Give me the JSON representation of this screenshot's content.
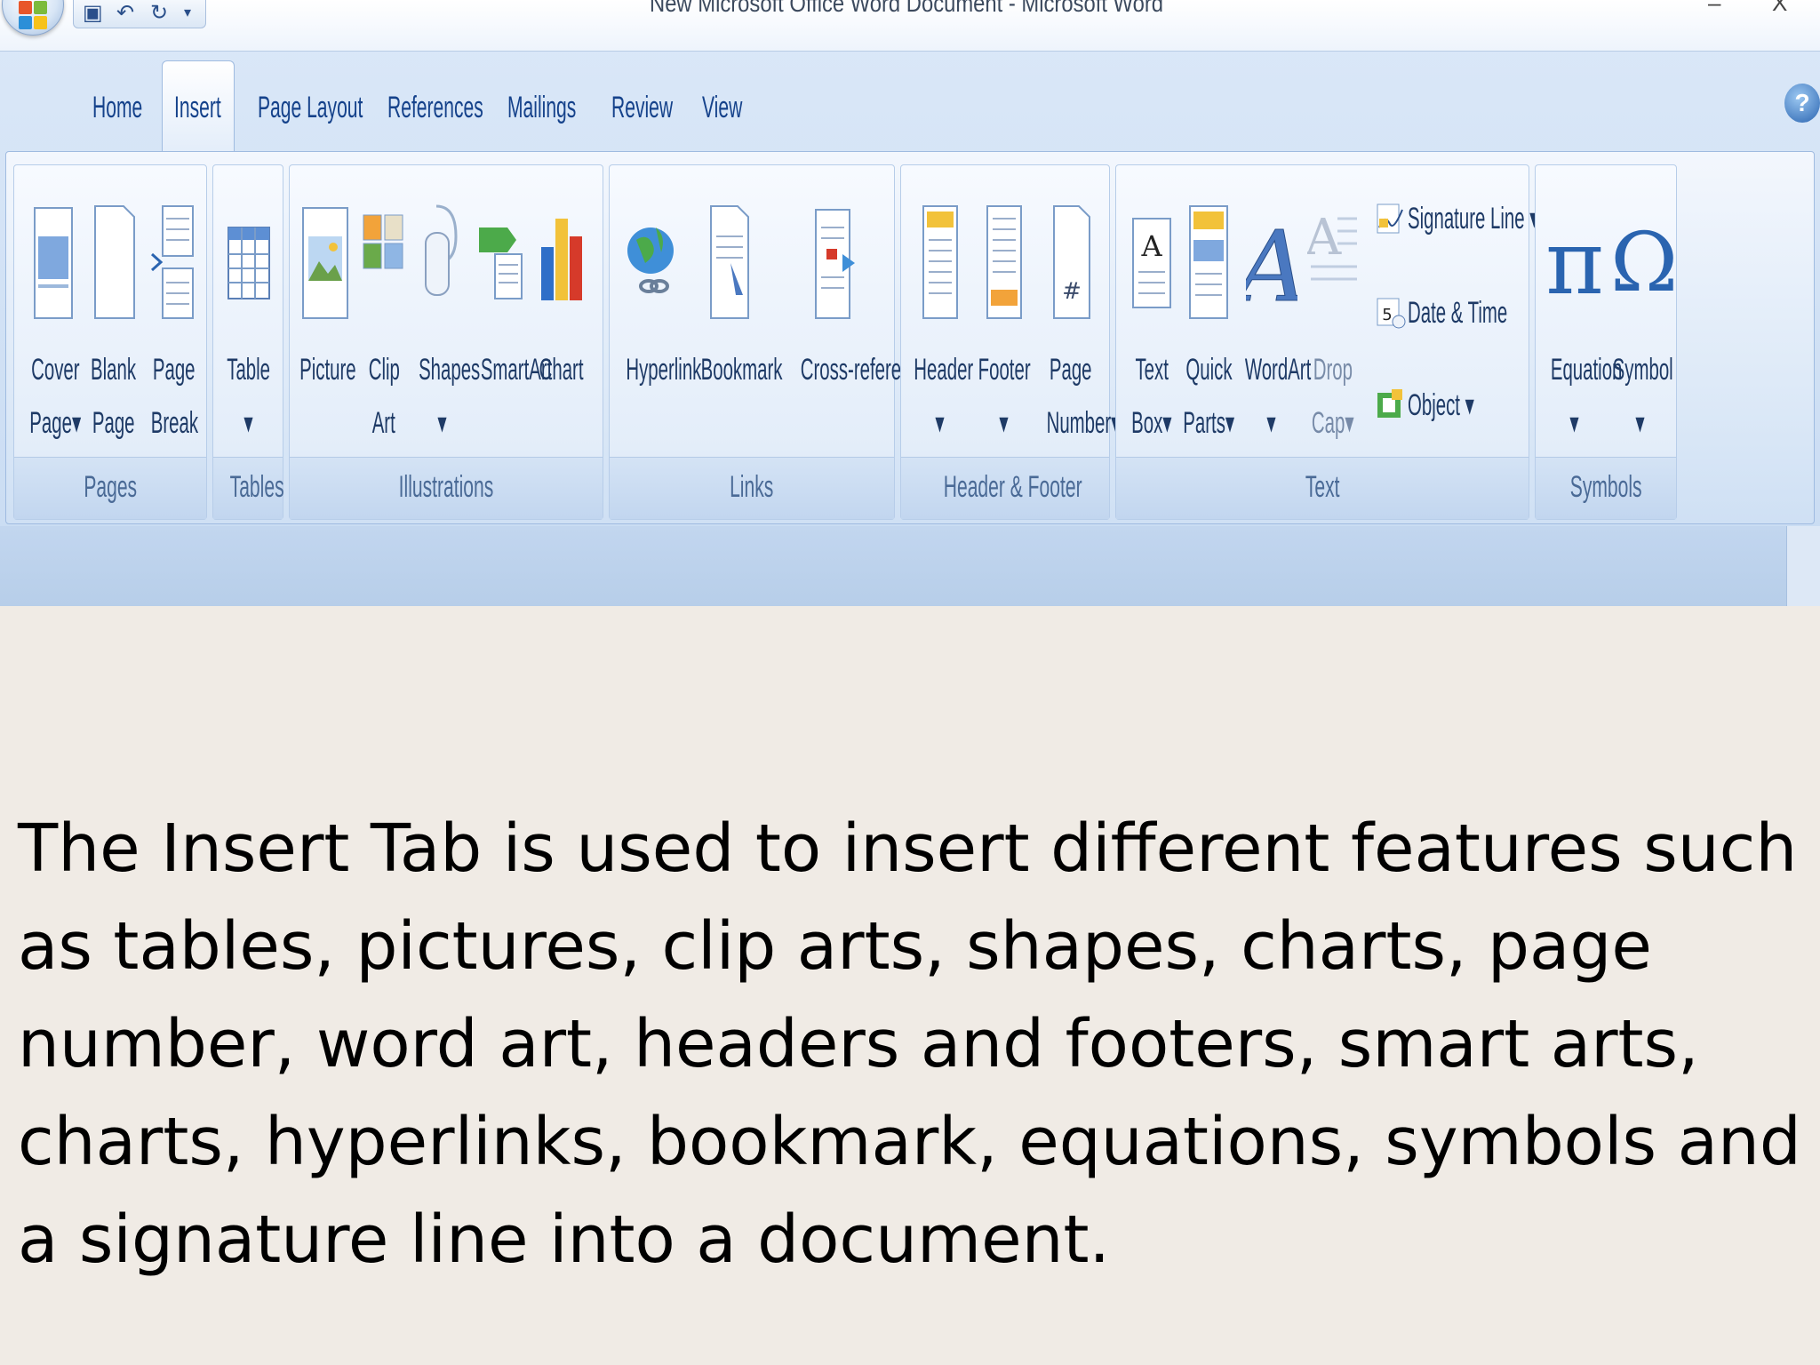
{
  "window": {
    "title": "New Microsoft Office Word Document - Microsoft Word",
    "minimize_glyph": "–",
    "close_glyph": "X"
  },
  "tabs": [
    {
      "label": "Home"
    },
    {
      "label": "Insert",
      "active": true
    },
    {
      "label": "Page Layout"
    },
    {
      "label": "References"
    },
    {
      "label": "Mailings"
    },
    {
      "label": "Review"
    },
    {
      "label": "View"
    }
  ],
  "help_glyph": "?",
  "ribbon": {
    "groups": {
      "pages": {
        "label": "Pages",
        "buttons": [
          {
            "line1": "Cover",
            "line2": "Page▾",
            "icon": "cover-page-icon"
          },
          {
            "line1": "Blank",
            "line2": "Page",
            "icon": "blank-page-icon"
          },
          {
            "line1": "Page",
            "line2": "Break",
            "icon": "page-break-icon"
          }
        ]
      },
      "tables": {
        "label": "Tables",
        "buttons": [
          {
            "line1": "Table",
            "line2": "▾",
            "icon": "table-icon"
          }
        ]
      },
      "illustrations": {
        "label": "Illustrations",
        "buttons": [
          {
            "line1": "Picture",
            "line2": "",
            "icon": "picture-icon"
          },
          {
            "line1": "Clip",
            "line2": "Art",
            "icon": "clip-art-icon"
          },
          {
            "line1": "Shapes",
            "line2": "▾",
            "icon": "shapes-icon"
          },
          {
            "line1": "SmartArt",
            "line2": "",
            "icon": "smartart-icon"
          },
          {
            "line1": "Chart",
            "line2": "",
            "icon": "chart-icon"
          }
        ]
      },
      "links": {
        "label": "Links",
        "buttons": [
          {
            "line1": "Hyperlink",
            "line2": "",
            "icon": "hyperlink-icon"
          },
          {
            "line1": "Bookmark",
            "line2": "",
            "icon": "bookmark-icon"
          },
          {
            "line1": "Cross-reference",
            "line2": "",
            "icon": "cross-reference-icon"
          }
        ]
      },
      "header_footer": {
        "label": "Header & Footer",
        "buttons": [
          {
            "line1": "Header",
            "line2": "▾",
            "icon": "header-icon"
          },
          {
            "line1": "Footer",
            "line2": "▾",
            "icon": "footer-icon"
          },
          {
            "line1": "Page",
            "line2": "Number▾",
            "icon": "page-number-icon"
          }
        ]
      },
      "text": {
        "label": "Text",
        "buttons": [
          {
            "line1": "Text",
            "line2": "Box▾",
            "icon": "text-box-icon"
          },
          {
            "line1": "Quick",
            "line2": "Parts▾",
            "icon": "quick-parts-icon"
          },
          {
            "line1": "WordArt",
            "line2": "▾",
            "icon": "wordart-icon"
          },
          {
            "line1": "Drop",
            "line2": "Cap▾",
            "icon": "drop-cap-icon"
          }
        ],
        "small_buttons": [
          {
            "label": "Signature Line ▾",
            "icon": "signature-line-icon"
          },
          {
            "label": "Date & Time",
            "icon": "date-time-icon"
          },
          {
            "label": "Object ▾",
            "icon": "object-icon"
          }
        ]
      },
      "symbols": {
        "label": "Symbols",
        "buttons": [
          {
            "line1": "Equation",
            "line2": "▾",
            "icon": "equation-icon",
            "glyph": "π"
          },
          {
            "line1": "Symbol",
            "line2": "▾",
            "icon": "symbol-icon",
            "glyph": "Ω"
          }
        ]
      }
    }
  },
  "caption": "The Insert Tab is used to insert different features such as tables, pictures, clip arts, shapes, charts, page number, word art, headers and footers, smart arts, charts, hyperlinks, bookmark, equations, symbols and a signature line into a document.",
  "colors": {
    "tab_text": "#15428b",
    "ribbon_bg": "#dbe8f7",
    "slide_bg": "#f0ebe5"
  }
}
